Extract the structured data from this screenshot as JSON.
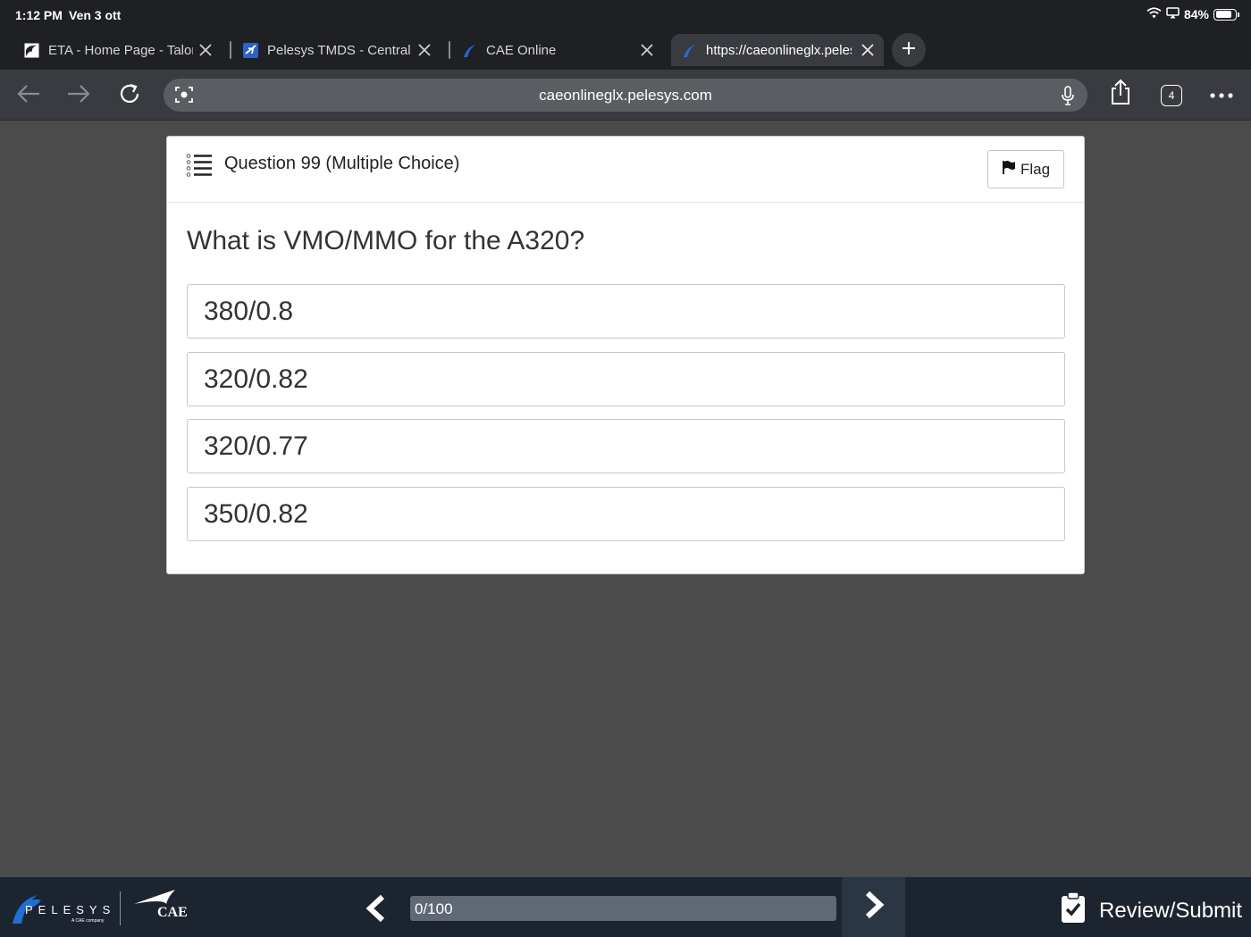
{
  "status_bar": {
    "time": "1:12 PM",
    "date": "Ven 3 ott",
    "battery": "84%",
    "battery_level": 0.84
  },
  "tabs": [
    {
      "title": "ETA - Home Page - Talon",
      "favicon": "talon-icon"
    },
    {
      "title": "Pelesys TMDS - Central",
      "favicon": "plane-icon"
    },
    {
      "title": "CAE Online",
      "favicon": "pelesys-icon"
    },
    {
      "title": "https://caeonlineglx.pelesys.com",
      "favicon": "pelesys-icon",
      "active": true
    }
  ],
  "toolbar": {
    "url": "caeonlineglx.pelesys.com",
    "tab_count": "4"
  },
  "question": {
    "header": "Question 99 (Multiple Choice)",
    "flag_label": "Flag",
    "text": "What is VMO/MMO for the A320?",
    "answers": [
      "380/0.8",
      "320/0.82",
      "320/0.77",
      "350/0.82"
    ]
  },
  "footer": {
    "pelesys_logo_text": "PELESYS",
    "pelesys_sub": "A CAE company",
    "cae_logo_text": "CAE",
    "progress_label": "0/100",
    "progress_fraction": 0,
    "review_label": "Review/Submit"
  },
  "colors": {
    "page_background": "#4b4b4b",
    "browser_chrome": "#1f2024",
    "footer_background": "#1c2430"
  }
}
